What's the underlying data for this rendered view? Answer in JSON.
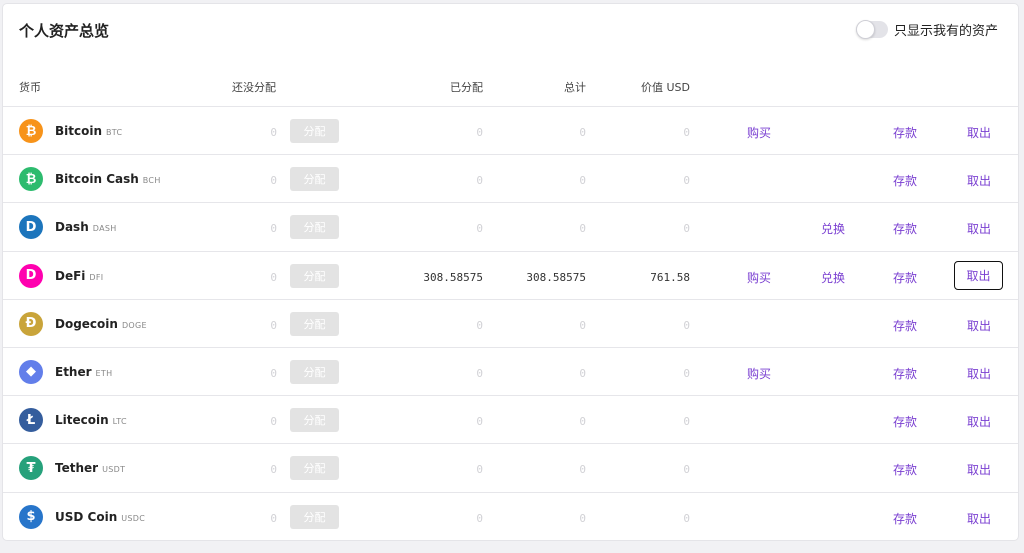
{
  "title": "个人资产总览",
  "toggle_label": "只显示我有的资产",
  "columns": {
    "currency": "货币",
    "unallocated": "还没分配",
    "allocated": "已分配",
    "total": "总计",
    "value_usd": "价值 USD"
  },
  "actions": {
    "allocate": "分配",
    "buy": "购买",
    "exchange": "兑换",
    "deposit": "存款",
    "withdraw": "取出"
  },
  "rows": [
    {
      "name": "Bitcoin",
      "symbol": "BTC",
      "icon": "bitcoin-icon",
      "color": "#f7931a",
      "glyph": "₿",
      "unallocated": "0",
      "allocated": "0",
      "total": "0",
      "value": "0",
      "buy": true,
      "exchange": false
    },
    {
      "name": "Bitcoin Cash",
      "symbol": "BCH",
      "icon": "bitcoin-cash-icon",
      "color": "#2dbb6e",
      "glyph": "₿",
      "unallocated": "0",
      "allocated": "0",
      "total": "0",
      "value": "0",
      "buy": false,
      "exchange": false
    },
    {
      "name": "Dash",
      "symbol": "DASH",
      "icon": "dash-icon",
      "color": "#1c75bc",
      "glyph": "D",
      "unallocated": "0",
      "allocated": "0",
      "total": "0",
      "value": "0",
      "buy": false,
      "exchange": true
    },
    {
      "name": "DeFi",
      "symbol": "DFI",
      "icon": "defi-icon",
      "color": "#ff00af",
      "glyph": "D",
      "unallocated": "0",
      "allocated": "308.58575",
      "total": "308.58575",
      "value": "761.58",
      "buy": true,
      "exchange": true
    },
    {
      "name": "Dogecoin",
      "symbol": "DOGE",
      "icon": "dogecoin-icon",
      "color": "#c9a43a",
      "glyph": "Ð",
      "unallocated": "0",
      "allocated": "0",
      "total": "0",
      "value": "0",
      "buy": false,
      "exchange": false
    },
    {
      "name": "Ether",
      "symbol": "ETH",
      "icon": "ether-icon",
      "color": "#627eea",
      "glyph": "◆",
      "unallocated": "0",
      "allocated": "0",
      "total": "0",
      "value": "0",
      "buy": true,
      "exchange": false
    },
    {
      "name": "Litecoin",
      "symbol": "LTC",
      "icon": "litecoin-icon",
      "color": "#345d9d",
      "glyph": "Ł",
      "unallocated": "0",
      "allocated": "0",
      "total": "0",
      "value": "0",
      "buy": false,
      "exchange": false
    },
    {
      "name": "Tether",
      "symbol": "USDT",
      "icon": "tether-icon",
      "color": "#26a17b",
      "glyph": "₮",
      "unallocated": "0",
      "allocated": "0",
      "total": "0",
      "value": "0",
      "buy": false,
      "exchange": false
    },
    {
      "name": "USD Coin",
      "symbol": "USDC",
      "icon": "usd-coin-icon",
      "color": "#2775ca",
      "glyph": "$",
      "unallocated": "0",
      "allocated": "0",
      "total": "0",
      "value": "0",
      "buy": false,
      "exchange": false
    }
  ],
  "focused_row": 3
}
